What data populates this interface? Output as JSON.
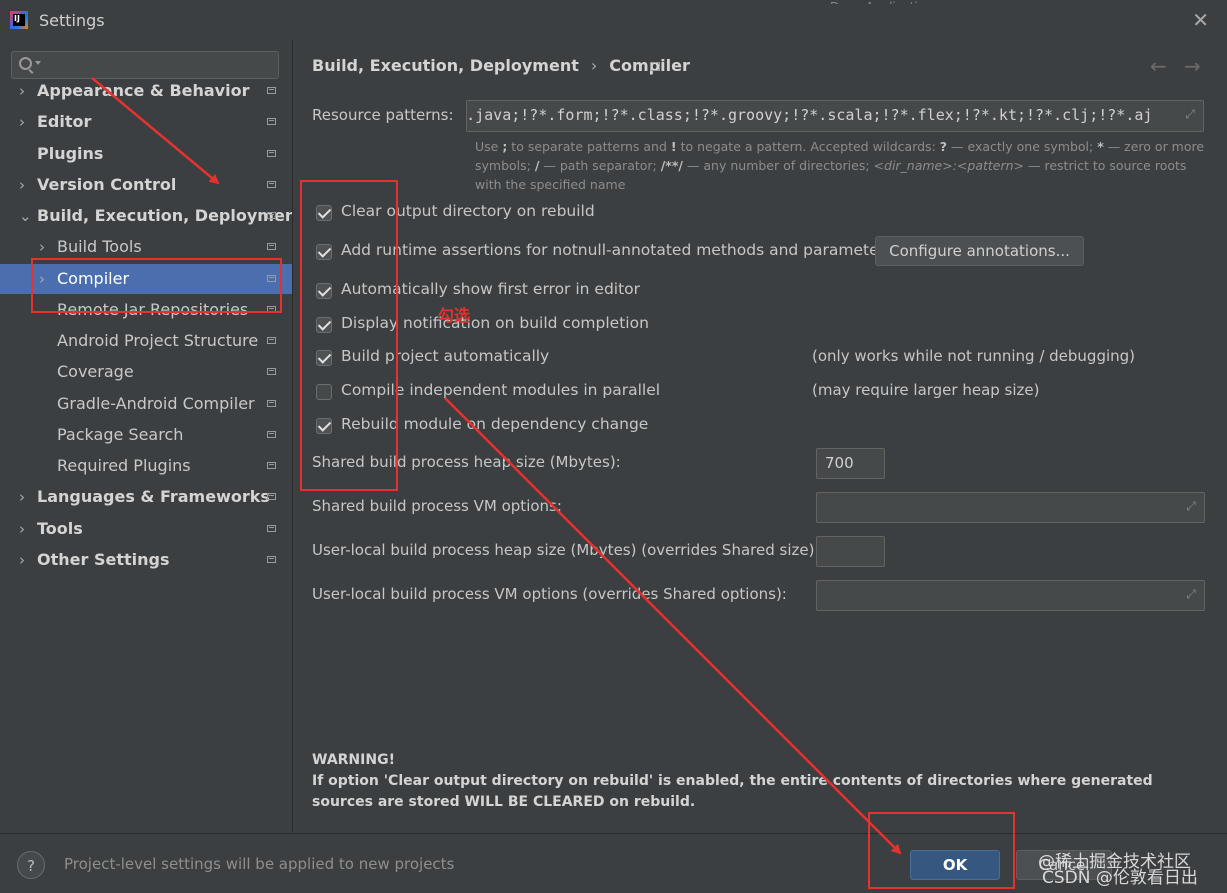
{
  "window": {
    "title": "Settings",
    "background_fragment": "DemoApplication"
  },
  "search": {
    "placeholder": ""
  },
  "sidebar": {
    "items": [
      {
        "label": "Appearance & Behavior",
        "chevron": "›"
      },
      {
        "label": "Editor",
        "chevron": "›"
      },
      {
        "label": "Plugins",
        "chevron": ""
      },
      {
        "label": "Version Control",
        "chevron": "›"
      },
      {
        "label": "Build, Execution, Deployment",
        "chevron": "⌄"
      },
      {
        "label": "Build Tools",
        "chevron": "›"
      },
      {
        "label": "Compiler",
        "chevron": "›"
      },
      {
        "label": "Remote Jar Repositories",
        "chevron": ""
      },
      {
        "label": "Android Project Structure",
        "chevron": ""
      },
      {
        "label": "Coverage",
        "chevron": ""
      },
      {
        "label": "Gradle-Android Compiler",
        "chevron": ""
      },
      {
        "label": "Package Search",
        "chevron": ""
      },
      {
        "label": "Required Plugins",
        "chevron": ""
      },
      {
        "label": "Languages & Frameworks",
        "chevron": "›"
      },
      {
        "label": "Tools",
        "chevron": "›"
      },
      {
        "label": "Other Settings",
        "chevron": "›"
      }
    ],
    "selected": "Compiler"
  },
  "breadcrumb": {
    "parent": "Build, Execution, Deployment",
    "separator": "›",
    "current": "Compiler"
  },
  "nav": {
    "back": "←",
    "forward": "→"
  },
  "resource_patterns": {
    "label": "Resource patterns:",
    "value": "!?*.java;!?*.form;!?*.class;!?*.groovy;!?*.scala;!?*.flex;!?*.kt;!?*.clj;!?*.aj",
    "help_line1_a": "Use ",
    "help_line1_b": ";",
    "help_line1_c": " to separate patterns and ",
    "help_line1_d": "!",
    "help_line1_e": " to negate a pattern. Accepted wildcards: ",
    "help_line1_f": "?",
    "help_line1_g": " — exactly one symbol; ",
    "help_line1_h": "*",
    "help_line1_i": " — zero or more",
    "help_line2_a": "symbols; ",
    "help_line2_b": "/",
    "help_line2_c": " — path separator; ",
    "help_line2_d": "/**/",
    "help_line2_e": " — any number of directories; ",
    "help_line2_f": "<dir_name>:<pattern>",
    "help_line2_g": " — restrict to source roots",
    "help_line3": "with the specified name"
  },
  "options": {
    "clear_output": {
      "label": "Clear output directory on rebuild",
      "checked": true
    },
    "runtime_assertions": {
      "label": "Add runtime assertions for notnull-annotated methods and parameters",
      "checked": true
    },
    "configure_annotations": "Configure annotations...",
    "show_first_error": {
      "label": "Automatically show first error in editor",
      "checked": true
    },
    "display_notification": {
      "label": "Display notification on build completion",
      "checked": true
    },
    "build_automatically": {
      "label": "Build project automatically",
      "checked": true,
      "note": "(only works while not running / debugging)"
    },
    "compile_parallel": {
      "label": "Compile independent modules in parallel",
      "checked": false,
      "note": "(may require larger heap size)"
    },
    "rebuild_on_dependency": {
      "label": "Rebuild module on dependency change",
      "checked": true
    }
  },
  "fields": {
    "shared_heap": {
      "label": "Shared build process heap size (Mbytes):",
      "value": "700"
    },
    "shared_vm": {
      "label": "Shared build process VM options:",
      "value": ""
    },
    "user_heap": {
      "label": "User-local build process heap size (Mbytes) (overrides Shared size):",
      "value": ""
    },
    "user_vm": {
      "label": "User-local build process VM options (overrides Shared options):",
      "value": ""
    }
  },
  "warning": {
    "title": "WARNING!",
    "body": "If option 'Clear output directory on rebuild' is enabled, the entire contents of directories where generated sources are stored WILL BE CLEARED on rebuild."
  },
  "footer": {
    "help": "?",
    "text": "Project-level settings will be applied to new projects",
    "ok": "OK",
    "cancel": "Cancel"
  },
  "annotation": {
    "text": "勾选",
    "color": "#e6322e"
  },
  "watermark": {
    "line1": "@稀土掘金技术社区",
    "line2": "CSDN @伦敦看日出"
  },
  "colors": {
    "accent": "#4b6eaf",
    "ok_button": "#365880",
    "annotation_red": "#e6322e"
  }
}
